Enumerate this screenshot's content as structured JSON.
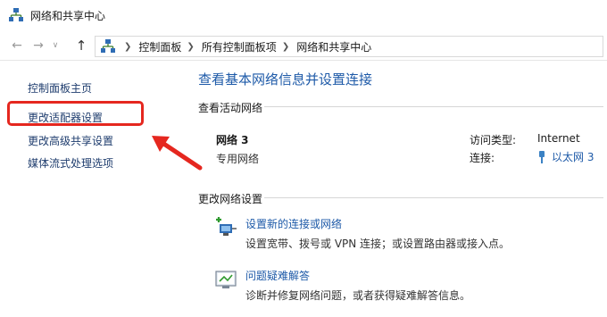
{
  "window": {
    "title": "网络和共享中心"
  },
  "nav": {
    "back_glyph": "←",
    "forward_glyph": "→",
    "dropdown_glyph": "∨",
    "up_glyph": "↑"
  },
  "breadcrumb": [
    "控制面板",
    "所有控制面板项",
    "网络和共享中心"
  ],
  "sidebar": {
    "items": [
      {
        "label": "控制面板主页"
      },
      {
        "label": "更改适配器设置",
        "highlighted": true
      },
      {
        "label": "更改高级共享设置"
      },
      {
        "label": "媒体流式处理选项"
      }
    ],
    "highlight_color": "#e5271f"
  },
  "main": {
    "title": "查看基本网络信息并设置连接",
    "active_networks": {
      "heading": "查看活动网络",
      "network_name": "网络 3",
      "network_category": "专用网络",
      "access_type_label": "访问类型:",
      "access_type_value": "Internet",
      "connections_label": "连接:",
      "connections_value": "以太网 3"
    },
    "change_settings": {
      "heading": "更改网络设置",
      "tasks": [
        {
          "link": "设置新的连接或网络",
          "description": "设置宽带、拨号或 VPN 连接；或设置路由器或接入点。",
          "icon": "new-connection-icon"
        },
        {
          "link": "问题疑难解答",
          "description": "诊断并修复网络问题，或者获得疑难解答信息。",
          "icon": "troubleshoot-icon"
        }
      ]
    }
  },
  "colors": {
    "link": "#1e5aa8",
    "sidebar_link": "#1f3d6e",
    "annotation": "#e5271f"
  }
}
